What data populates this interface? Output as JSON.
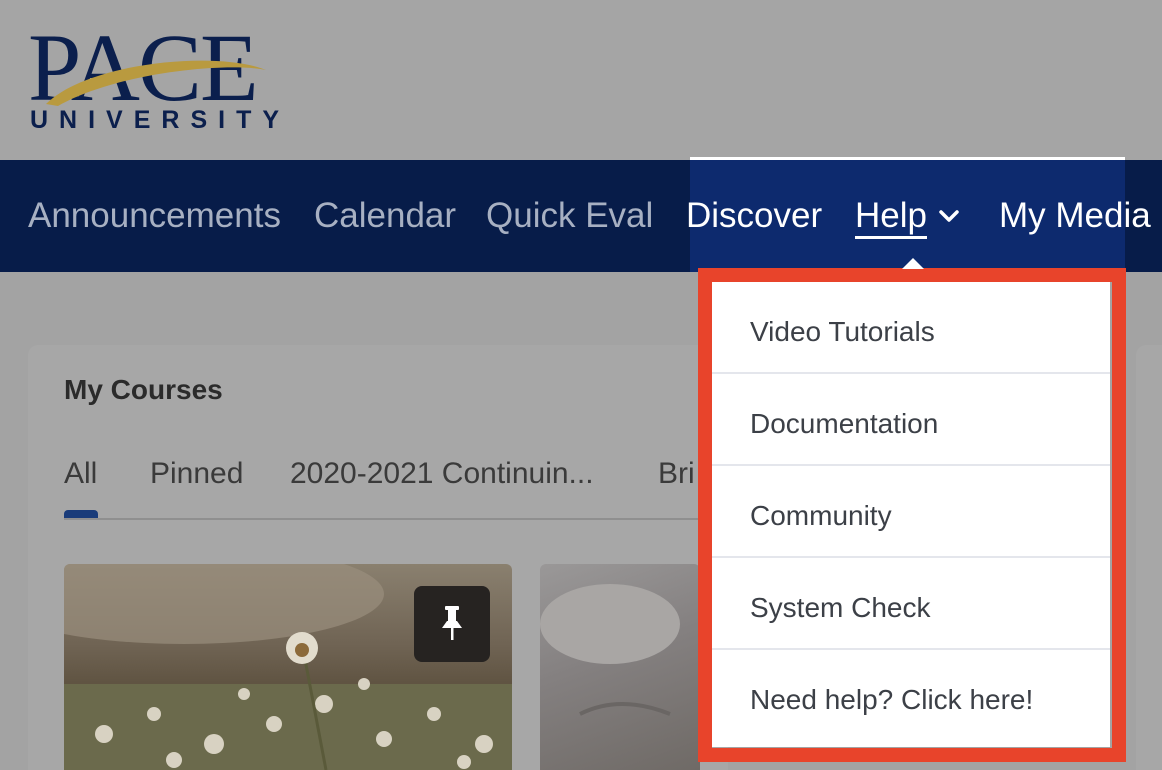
{
  "logo": {
    "word": "PACE",
    "sub": "UNIVERSITY"
  },
  "nav": {
    "items": [
      "Announcements",
      "Calendar",
      "Quick Eval",
      "Discover",
      "Help",
      "My Media"
    ]
  },
  "help_menu": {
    "items": [
      "Video Tutorials",
      "Documentation",
      "Community",
      "System Check",
      "Need help? Click here!"
    ]
  },
  "my_courses": {
    "title": "My Courses",
    "tabs": [
      "All",
      "Pinned",
      "2020-2021 Continuin...",
      "Bri"
    ]
  },
  "colors": {
    "navbar": "#071c49",
    "highlight": "#e8442b",
    "logo_navy": "#0b1f4d",
    "logo_gold": "#b99a3f"
  }
}
